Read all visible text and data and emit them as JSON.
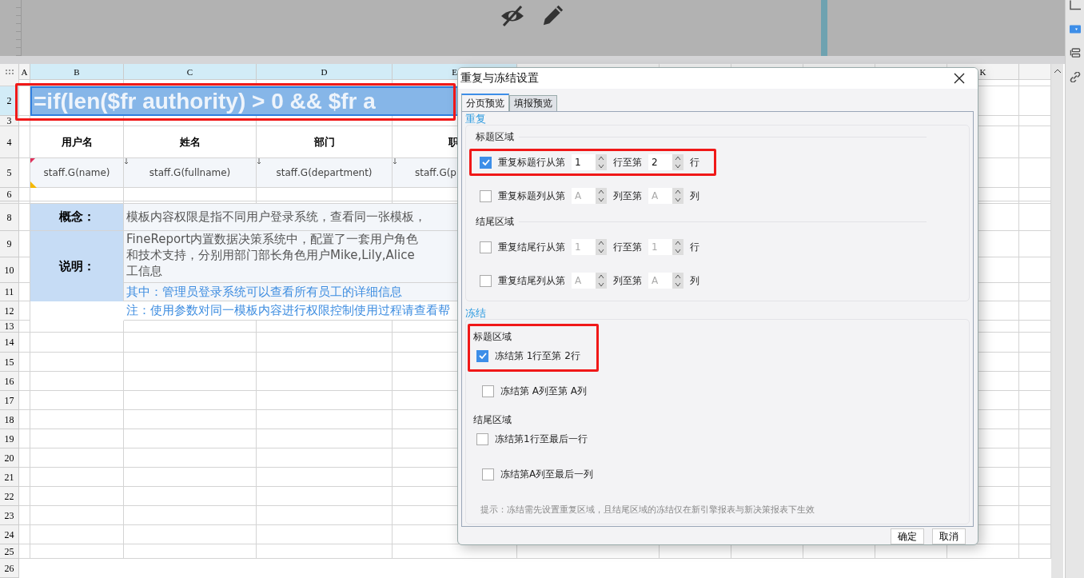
{
  "column_headers": [
    {
      "label": "A",
      "selected": false
    },
    {
      "label": "B",
      "selected": true
    },
    {
      "label": "C",
      "selected": true
    },
    {
      "label": "D",
      "selected": true
    },
    {
      "label": "E",
      "selected": true
    },
    {
      "label": "K",
      "selected": false
    }
  ],
  "row_headers": [
    {
      "label": "2",
      "selected": true
    },
    {
      "label": "3",
      "selected": false
    },
    {
      "label": "4",
      "selected": false
    },
    {
      "label": "5",
      "selected": false
    },
    {
      "label": "6",
      "selected": false
    },
    {
      "label": "8",
      "selected": false
    },
    {
      "label": "9",
      "selected": false
    },
    {
      "label": "10",
      "selected": false
    },
    {
      "label": "11",
      "selected": false
    },
    {
      "label": "12",
      "selected": false
    },
    {
      "label": "13",
      "selected": false
    },
    {
      "label": "14",
      "selected": false
    },
    {
      "label": "15",
      "selected": false
    },
    {
      "label": "16",
      "selected": false
    },
    {
      "label": "17",
      "selected": false
    },
    {
      "label": "18",
      "selected": false
    },
    {
      "label": "19",
      "selected": false
    },
    {
      "label": "20",
      "selected": false
    },
    {
      "label": "21",
      "selected": false
    },
    {
      "label": "22",
      "selected": false
    },
    {
      "label": "23",
      "selected": false
    },
    {
      "label": "24",
      "selected": false
    },
    {
      "label": "25",
      "selected": false
    },
    {
      "label": "26",
      "selected": false
    }
  ],
  "formula_cell": {
    "text": "=if(len($fr authority) > 0 && $fr a",
    "selected": true,
    "annotated": true
  },
  "header_row": [
    "用户名",
    "姓名",
    "部门",
    "职"
  ],
  "field_row": [
    "staff.G(name)",
    "staff.G(fullname)",
    "staff.G(department)",
    "staff.G(p"
  ],
  "concept": {
    "label": "概念：",
    "text": "模板内容权限是指不同用户登录系统，查看同一张模板，"
  },
  "description": {
    "label": "说明：",
    "lines": [
      "FineReport内置数据决策系统中，配置了一套用户角色",
      "和技术支持，分别用部门部长角色用户Mike,Lily,Alice",
      "工信息"
    ],
    "note": "其中：管理员登录系统可以查看所有员工的详细信息"
  },
  "footnote": "注：使用参数对同一模板内容进行权限控制使用过程请查看帮",
  "dialog": {
    "title": "重复与冻结设置",
    "tabs": [
      {
        "label": "分页预览",
        "selected": true
      },
      {
        "label": "填报预览",
        "selected": false
      }
    ],
    "repeat": {
      "title": "重复",
      "groups": [
        {
          "heading": "标题区域",
          "options": [
            {
              "label": "重复标题行从第",
              "checked": true,
              "annotated": true,
              "from": "1",
              "middle": "行至第",
              "to": "2",
              "unit": "行"
            },
            {
              "label": "重复标题列从第",
              "checked": false,
              "annotated": false,
              "from": "A",
              "middle": "列至第",
              "to": "A",
              "unit": "列"
            }
          ]
        },
        {
          "heading": "结尾区域",
          "options": [
            {
              "label": "重复结尾行从第",
              "checked": false,
              "annotated": false,
              "from": "1",
              "middle": "行至第",
              "to": "1",
              "unit": "行"
            },
            {
              "label": "重复结尾列从第",
              "checked": false,
              "annotated": false,
              "from": "A",
              "middle": "列至第",
              "to": "A",
              "unit": "列"
            }
          ]
        }
      ]
    },
    "freeze": {
      "title": "冻结",
      "groups": [
        {
          "heading": "标题区域",
          "annotated": true,
          "options": [
            {
              "label": "冻结第 1行至第 2行",
              "checked": true
            },
            {
              "label": "冻结第 A列至第 A列",
              "checked": false
            }
          ]
        },
        {
          "heading": "结尾区域",
          "annotated": false,
          "options": [
            {
              "label": "冻结第1行至最后一行",
              "checked": false
            },
            {
              "label": "冻结第A列至最后一列",
              "checked": false
            }
          ]
        }
      ],
      "hint": "提示：冻结需先设置重复区域，且结尾区域的冻结仅在新引擎报表与新决策报表下生效"
    },
    "buttons": [
      "确定",
      "取消"
    ]
  }
}
